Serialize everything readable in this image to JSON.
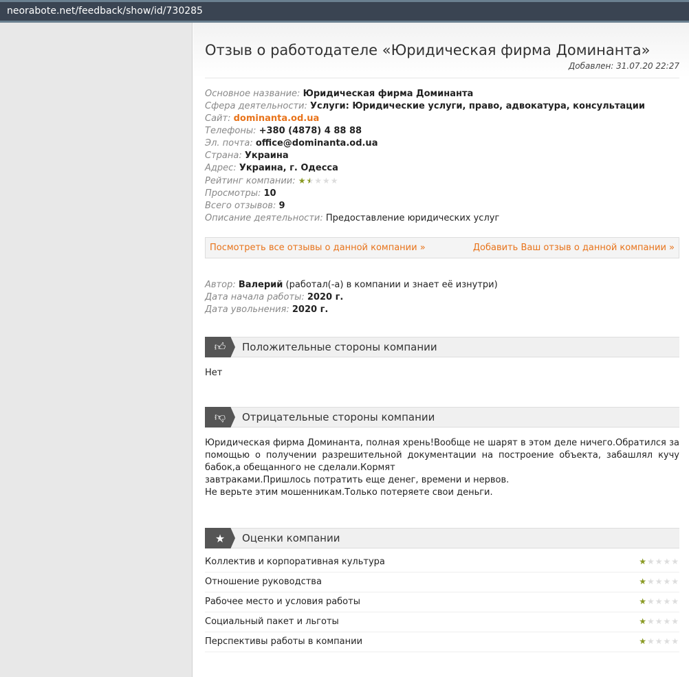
{
  "browser": {
    "url": "neorabote.net/feedback/show/id/730285"
  },
  "page": {
    "title": "Отзыв о работодателе «Юридическая фирма Доминанта»",
    "added": "Добавлен: 31.07.20 22:27"
  },
  "info": [
    {
      "label": "Основное название:",
      "value": "Юридическая фирма Доминанта",
      "type": "bold"
    },
    {
      "label": "Сфера деятельности:",
      "value": "Услуги: Юридические услуги, право, адвокатура, консультации",
      "type": "bold"
    },
    {
      "label": "Сайт:",
      "value": "dominanta.od.ua",
      "type": "link"
    },
    {
      "label": "Телефоны:",
      "value": "+380 (4878) 4 88 88",
      "type": "bold"
    },
    {
      "label": "Эл. почта:",
      "value": "office@dominanta.od.ua",
      "type": "bold"
    },
    {
      "label": "Страна:",
      "value": "Украина",
      "type": "bold"
    },
    {
      "label": "Адрес:",
      "value": "Украина, г. Одесса",
      "type": "bold"
    },
    {
      "label": "Рейтинг компании:",
      "rating": 1.5,
      "type": "rating"
    },
    {
      "label": "Просмотры:",
      "value": "10",
      "type": "bold"
    },
    {
      "label": "Всего отзывов:",
      "value": "9",
      "type": "bold"
    },
    {
      "label": "Описание деятельности:",
      "value": "Предоставление юридических услуг",
      "type": "plain"
    }
  ],
  "links": {
    "all": "Посмотреть все отзывы о данной компании »",
    "add": "Добавить Ваш отзыв о данной компании »"
  },
  "author": {
    "label": "Автор:",
    "name": "Валерий",
    "note": "(работал(-а) в компании и знает её изнутри)",
    "start_label": "Дата начала работы:",
    "start": "2020 г.",
    "end_label": "Дата увольнения:",
    "end": "2020 г."
  },
  "positive": {
    "title": "Положительные стороны компании",
    "text": "Нет"
  },
  "negative": {
    "title": "Отрицательные стороны компании",
    "lines": [
      "Юридическая фирма Доминанта, полная хрень!Вообще не шарят в этом деле ничего.Обратился за помощью о получении разрешительной документации на построение объекта, забашлял кучу бабок,а обещанного не сделали.Кормят",
      "завтраками.Пришлось потратить еще денег, времени и нервов.",
      "Не верьте этим мошенникам.Только потеряете свои деньги."
    ]
  },
  "ratings": {
    "title": "Оценки компании",
    "items": [
      {
        "label": "Коллектив и корпоративная культура",
        "value": 1
      },
      {
        "label": "Отношение руководства",
        "value": 1
      },
      {
        "label": "Рабочее место и условия работы",
        "value": 1
      },
      {
        "label": "Социальный пакет и льготы",
        "value": 1
      },
      {
        "label": "Перспективы работы в компании",
        "value": 1
      }
    ]
  }
}
